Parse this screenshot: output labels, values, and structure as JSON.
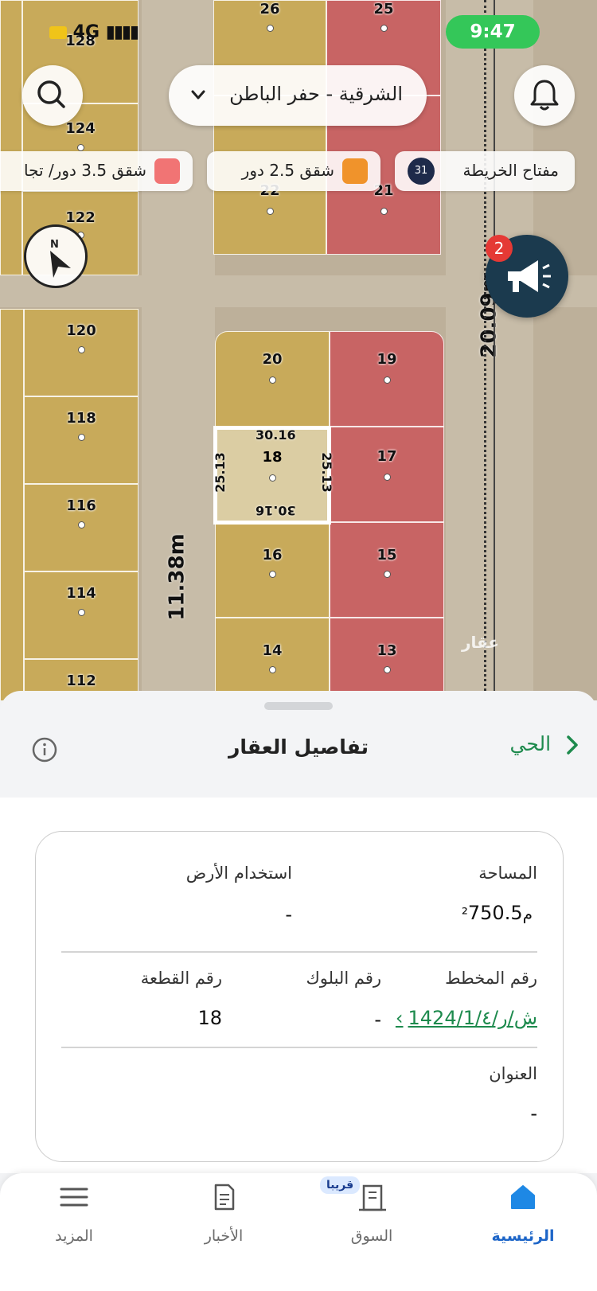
{
  "status_bar": {
    "network": "4G",
    "time": "9:47"
  },
  "map": {
    "location_selector": {
      "label": "الشرقية - حفر الباطن"
    },
    "legend": [
      {
        "label": "مفتاح الخريطة",
        "badge": "31"
      },
      {
        "label": "شقق 2.5 دور",
        "color": "#f0932b"
      },
      {
        "label": "شقق 3.5 دور/ تجا",
        "color": "#f17474"
      }
    ],
    "notification_badge": "2",
    "lots": [
      "26",
      "25",
      "128",
      "124",
      "122",
      "22",
      "21",
      "120",
      "20",
      "19",
      "118",
      "18",
      "17",
      "116",
      "16",
      "15",
      "114",
      "14",
      "13",
      "112"
    ],
    "selected_lot": {
      "number": "18",
      "top": "30.16",
      "bottom": "30.16",
      "left": "25.13",
      "right": "25.13"
    },
    "road_widths": [
      "20.09m",
      "11.38m"
    ],
    "watermark": "عقار"
  },
  "sheet": {
    "back_label": "الحي",
    "title": "تفاصيل العقار",
    "area_label": "المساحة",
    "area_value": "750.5",
    "area_unit": "م²",
    "land_use_label": "استخدام الأرض",
    "land_use_value": "-",
    "plan_label": "رقم المخطط",
    "plan_value": "1424/ش/ر/1/٤",
    "block_label": "رقم البلوك",
    "block_value": "-",
    "parcel_label": "رقم القطعة",
    "parcel_value": "18",
    "address_label": "العنوان",
    "address_value": "-"
  },
  "nav": {
    "home": "الرئيسية",
    "market": "السوق",
    "market_badge": "قريبا",
    "news": "الأخبار",
    "more": "المزيد"
  }
}
